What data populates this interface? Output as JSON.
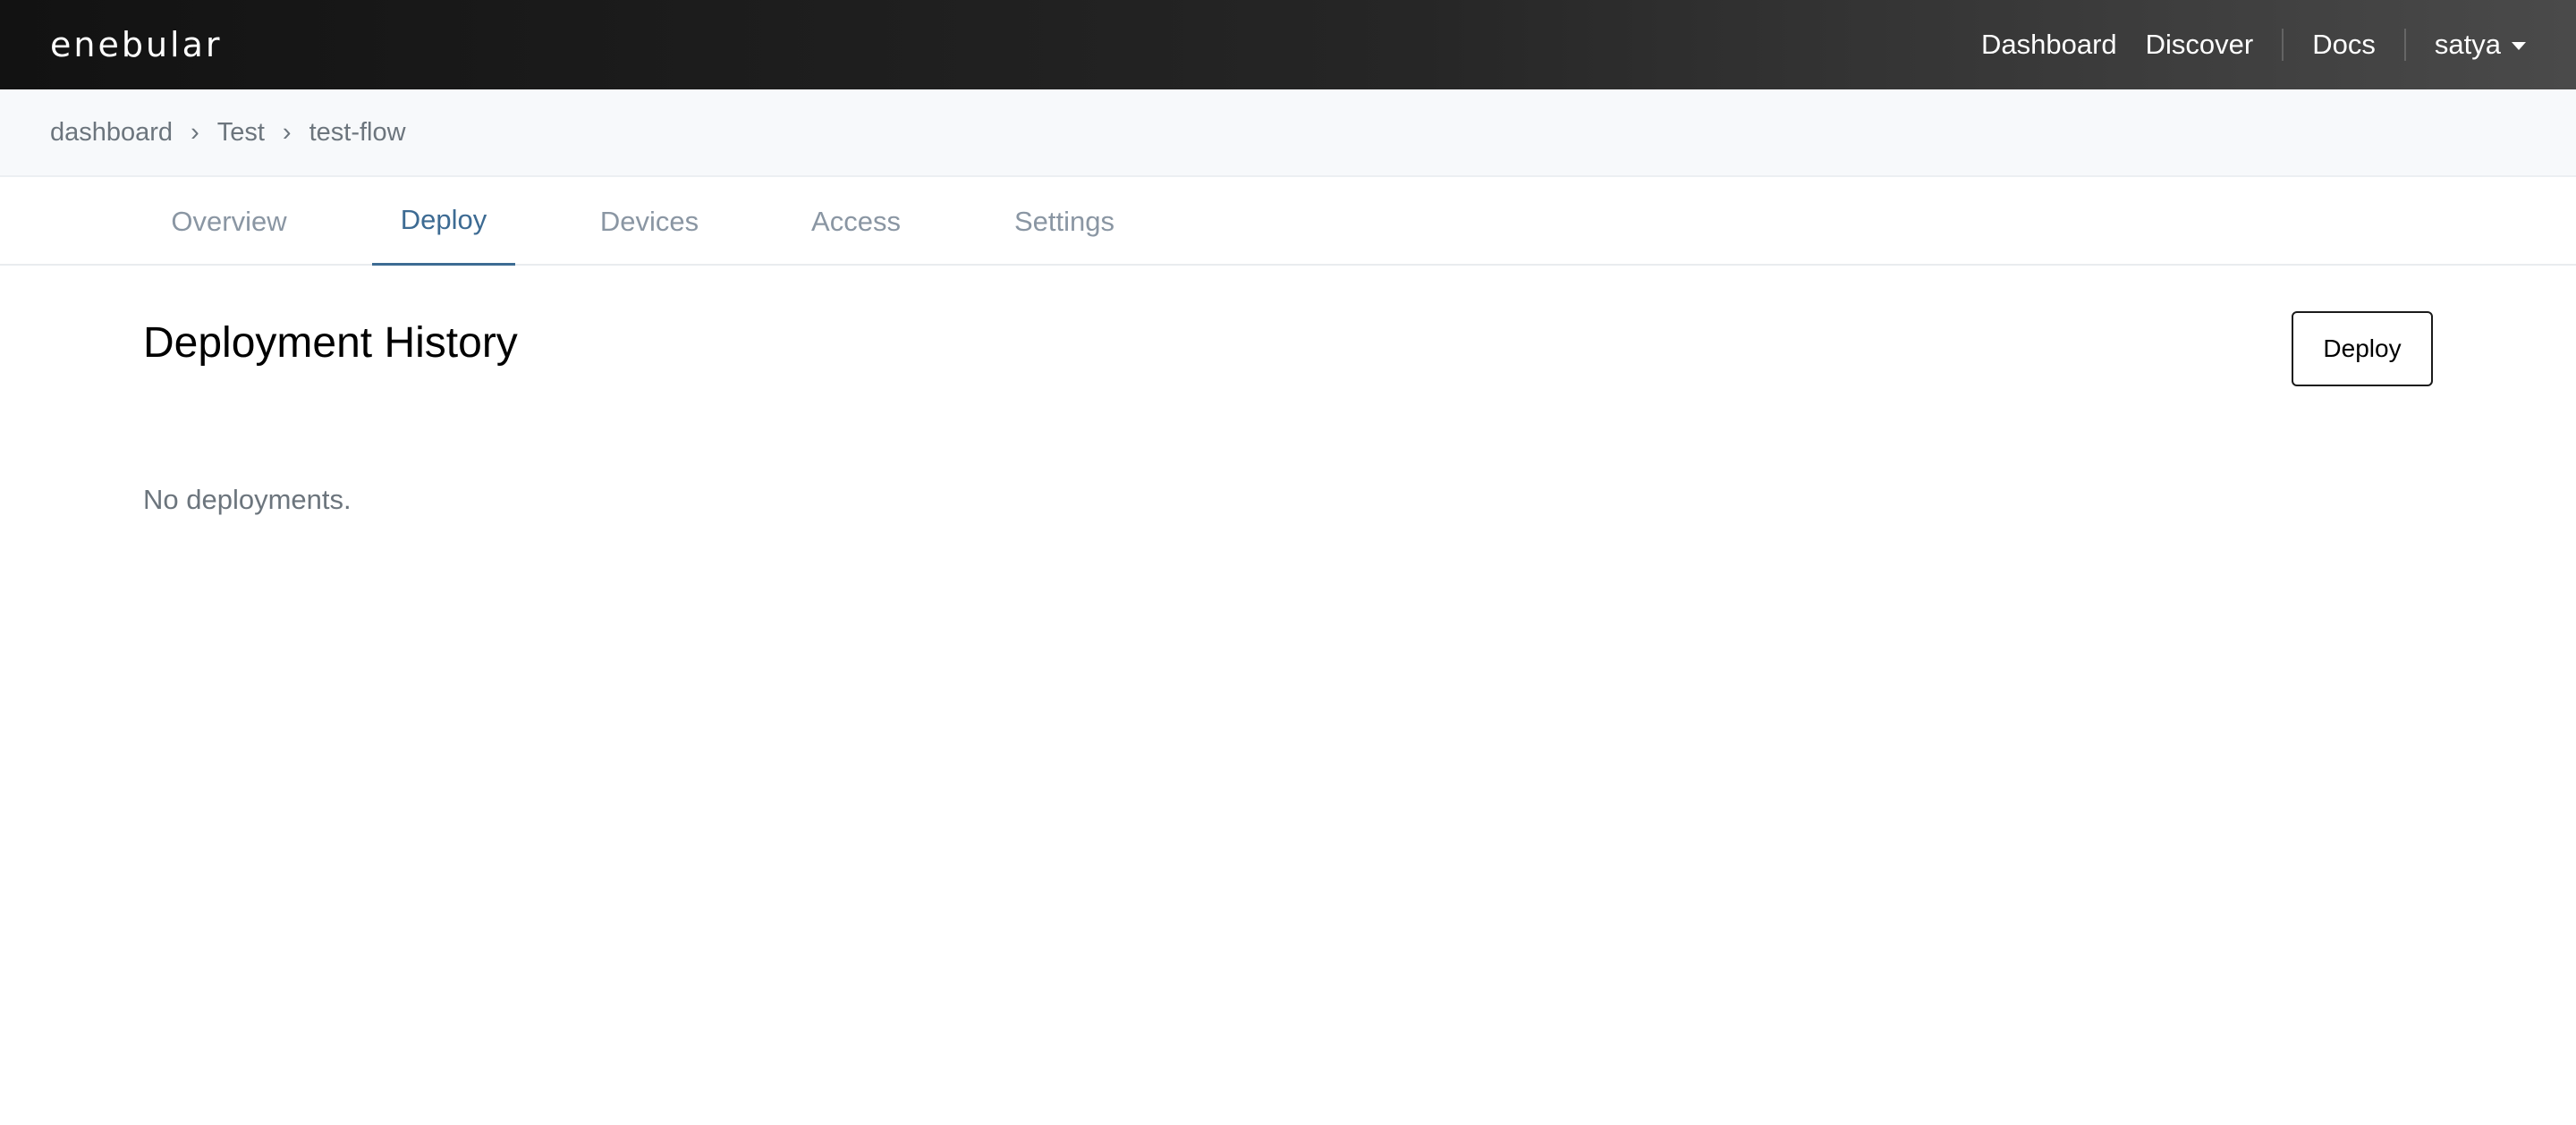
{
  "header": {
    "logo": "enebular",
    "nav": {
      "dashboard": "Dashboard",
      "discover": "Discover",
      "docs": "Docs"
    },
    "user": {
      "name": "satya",
      "icon": "chevron-down-icon"
    }
  },
  "breadcrumb": {
    "items": [
      "dashboard",
      "Test",
      "test-flow"
    ],
    "separator": "›"
  },
  "tabs": {
    "items": [
      "Overview",
      "Deploy",
      "Devices",
      "Access",
      "Settings"
    ],
    "active": "Deploy"
  },
  "main": {
    "title": "Deployment History",
    "deploy_button": "Deploy",
    "empty_message": "No deployments."
  },
  "colors": {
    "accent": "#3d6b93",
    "muted_text": "#6c757d",
    "topbar_start": "#121212",
    "topbar_end": "#4a4a4a"
  }
}
